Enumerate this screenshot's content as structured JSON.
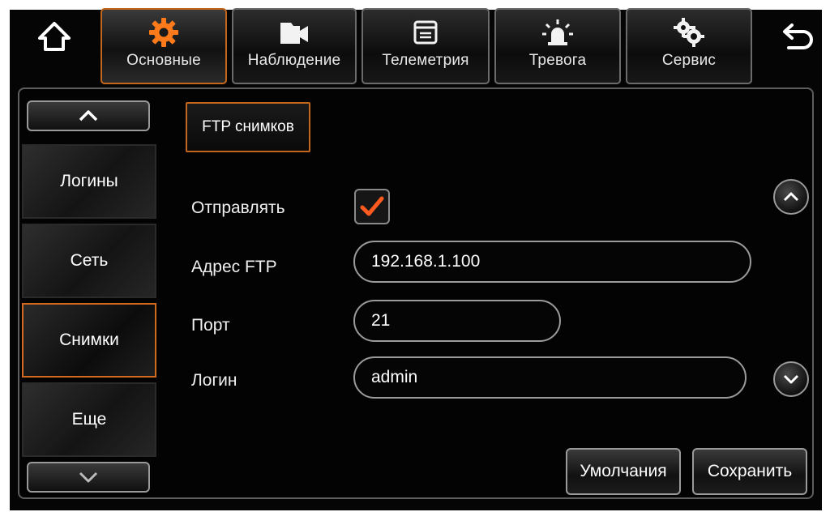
{
  "tabs": [
    {
      "label": "Основные",
      "icon": "gear-icon",
      "active": true
    },
    {
      "label": "Наблюдение",
      "icon": "video-camera-icon",
      "active": false
    },
    {
      "label": "Телеметрия",
      "icon": "window-icon",
      "active": false
    },
    {
      "label": "Тревога",
      "icon": "alarm-light-icon",
      "active": false
    },
    {
      "label": "Сервис",
      "icon": "gears-icon",
      "active": false
    }
  ],
  "sidebar": {
    "items": [
      {
        "label": "Логины"
      },
      {
        "label": "Сеть"
      },
      {
        "label": "Снимки"
      },
      {
        "label": "Еще"
      }
    ],
    "active": "Снимки"
  },
  "section": {
    "title": "FTP снимков"
  },
  "form": {
    "send_label": "Отправлять",
    "send_checked": true,
    "address_label": "Адрес FTP",
    "address_value": "192.168.1.100",
    "port_label": "Порт",
    "port_value": "21",
    "login_label": "Логин",
    "login_value": "admin"
  },
  "buttons": {
    "defaults": "Умолчания",
    "save": "Сохранить"
  },
  "colors": {
    "accent": "#d2691e",
    "checkmark": "#ff5a1f",
    "background": "#050505"
  }
}
